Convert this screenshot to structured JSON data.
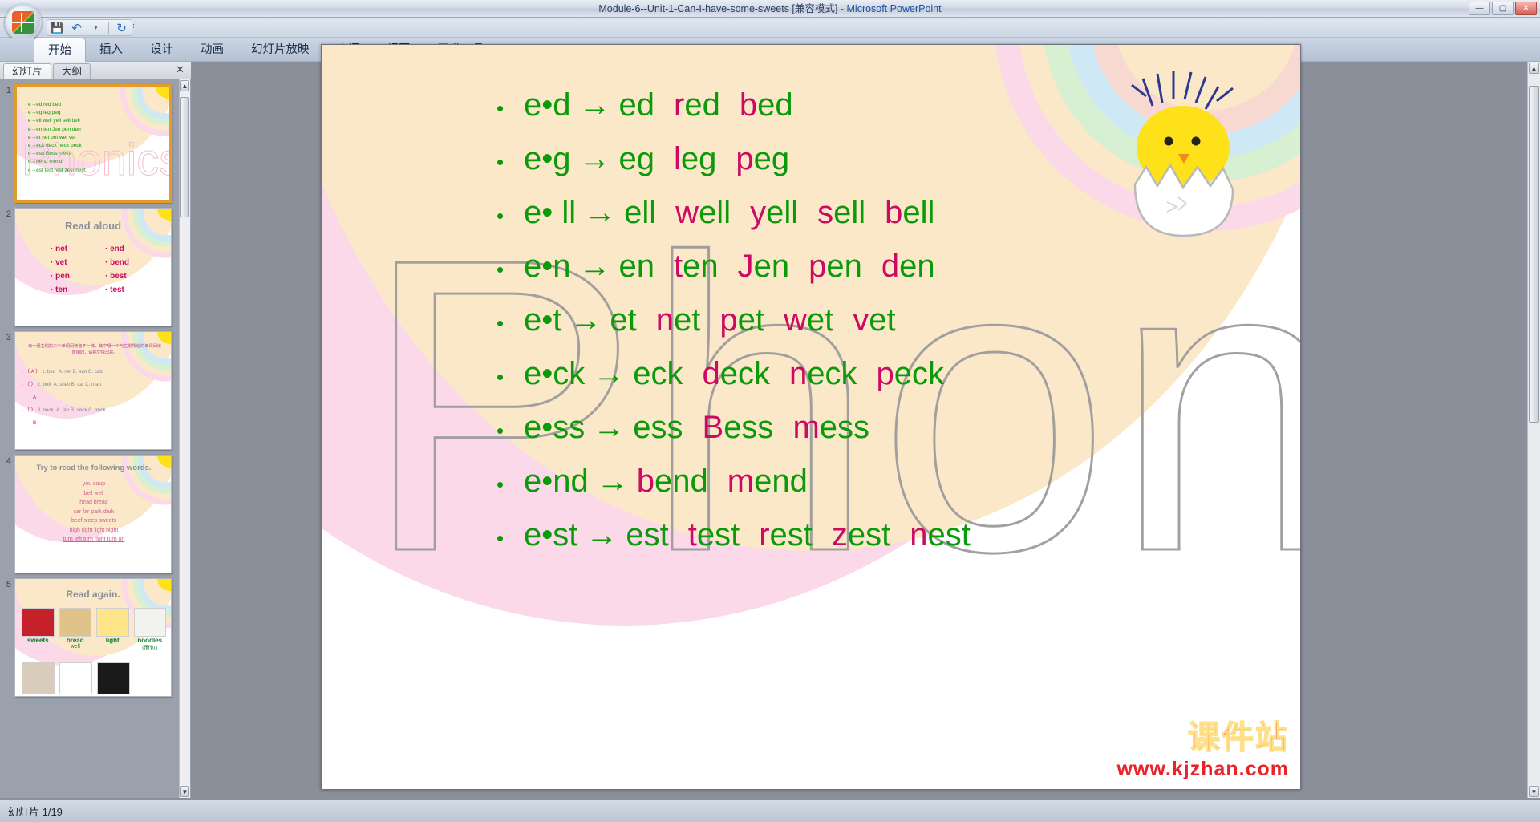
{
  "window": {
    "title": "Module-6--Unit-1-Can-I-have-some-sweets [兼容模式]",
    "separator": " - ",
    "app": "Microsoft PowerPoint",
    "minimize": "—",
    "maximize": "▢",
    "close": "✕"
  },
  "quick_access": {
    "save": "💾",
    "undo": "↶",
    "redo": "↻",
    "more": "▾",
    "customize": "⋮"
  },
  "ribbon": {
    "tabs": [
      {
        "label": "开始",
        "active": true
      },
      {
        "label": "插入",
        "active": false
      },
      {
        "label": "设计",
        "active": false
      },
      {
        "label": "动画",
        "active": false
      },
      {
        "label": "幻灯片放映",
        "active": false
      },
      {
        "label": "审阅",
        "active": false
      },
      {
        "label": "视图",
        "active": false
      },
      {
        "label": "开发工具",
        "active": false
      }
    ]
  },
  "left_pane": {
    "tab_slides": "幻灯片",
    "tab_outline": "大纲",
    "close": "✕",
    "scroll_up": "▲",
    "scroll_down": "▼",
    "thumbnails": [
      {
        "number": "1",
        "selected": true,
        "kind": "phonics",
        "lines": [
          "e→ed  red  bed",
          "e→eg  leg  peg",
          "e→ell  well  yell  sell  bell",
          "e→en  ten  Jen  pen  den",
          "e→et  net  pet  wet  vet",
          "e→eck  deck  neck  peck",
          "e→ess  Bess  mess",
          "e→bend  mend",
          "e→est  test  rest  zest  nest"
        ]
      },
      {
        "number": "2",
        "selected": false,
        "kind": "read-aloud",
        "title": "Read aloud",
        "col1": [
          "net",
          "vet",
          "pen",
          "ten"
        ],
        "col2": [
          "end",
          "bend",
          "best",
          "test"
        ]
      },
      {
        "number": "3",
        "selected": false,
        "kind": "quiz",
        "prompt": "每一组右侧的三个单词间读音不一样，其中哪一个与左侧所给的单词间读音相同，请把它找出来。",
        "questions": [
          {
            "bracket": "（ A ）",
            "stem": "1. bed",
            "options": "A. net    B. sun    C. cab",
            "answer": ""
          },
          {
            "bracket": "（   ）",
            "stem": "2. bell",
            "options": "A. shell   B. cat    C. map",
            "answer": "A"
          },
          {
            "bracket": "（   ）",
            "stem": "3. neck",
            "options": "A. fan     B. deck   C. truck",
            "answer": "B"
          }
        ]
      },
      {
        "number": "4",
        "selected": false,
        "kind": "read-words",
        "title": "Try to read the following  words.",
        "rows": [
          "you  soup",
          "bell  well",
          "head  bread",
          "car  far  park  dark",
          "beef  sleep  sweets",
          "high  right  light  night",
          "turn left   turn right   turn on"
        ]
      },
      {
        "number": "5",
        "selected": false,
        "kind": "read-again",
        "title": "Read again.",
        "cells": [
          "sweets",
          "bread",
          "light",
          "noodles"
        ],
        "cell_sub": [
          "",
          "well",
          "",
          "（面包）"
        ]
      }
    ]
  },
  "slide": {
    "watermark": "Phonics",
    "rows": [
      {
        "bullet": "•",
        "pattern_pre": "e•d",
        "arrow": "→",
        "words": [
          {
            "onset": "",
            "rime": "ed"
          },
          {
            "onset": "r",
            "rime": "ed"
          },
          {
            "onset": "b",
            "rime": "ed"
          }
        ]
      },
      {
        "bullet": "•",
        "pattern_pre": "e•g",
        "arrow": "→",
        "words": [
          {
            "onset": "",
            "rime": "eg"
          },
          {
            "onset": "l",
            "rime": "eg"
          },
          {
            "onset": "p",
            "rime": "eg"
          }
        ]
      },
      {
        "bullet": "•",
        "pattern_pre": "e• ll",
        "arrow": "→",
        "words": [
          {
            "onset": "",
            "rime": "ell"
          },
          {
            "onset": "w",
            "rime": "ell"
          },
          {
            "onset": "y",
            "rime": "ell"
          },
          {
            "onset": "s",
            "rime": "ell"
          },
          {
            "onset": "b",
            "rime": "ell"
          }
        ]
      },
      {
        "bullet": "•",
        "pattern_pre": "e•n",
        "arrow": "→",
        "words": [
          {
            "onset": "",
            "rime": "en"
          },
          {
            "onset": "t",
            "rime": "en"
          },
          {
            "onset": "J",
            "rime": "en"
          },
          {
            "onset": "p",
            "rime": "en"
          },
          {
            "onset": "d",
            "rime": "en"
          }
        ]
      },
      {
        "bullet": "•",
        "pattern_pre": "e•t",
        "arrow": "→",
        "words": [
          {
            "onset": "",
            "rime": "et"
          },
          {
            "onset": "n",
            "rime": "et"
          },
          {
            "onset": "p",
            "rime": "et"
          },
          {
            "onset": "w",
            "rime": "et"
          },
          {
            "onset": "v",
            "rime": "et"
          }
        ]
      },
      {
        "bullet": "•",
        "pattern_pre": "e•ck",
        "arrow": "→",
        "words": [
          {
            "onset": "",
            "rime": "eck"
          },
          {
            "onset": "d",
            "rime": "eck"
          },
          {
            "onset": "n",
            "rime": "eck"
          },
          {
            "onset": "p",
            "rime": "eck"
          }
        ]
      },
      {
        "bullet": "•",
        "pattern_pre": "e•ss",
        "arrow": "→",
        "words": [
          {
            "onset": "",
            "rime": "ess"
          },
          {
            "onset": "B",
            "rime": "ess"
          },
          {
            "onset": "m",
            "rime": "ess"
          }
        ]
      },
      {
        "bullet": "•",
        "pattern_pre": "e•nd",
        "arrow": "→",
        "words": [
          {
            "onset": "b",
            "rime": "end"
          },
          {
            "onset": "m",
            "rime": "end"
          }
        ]
      },
      {
        "bullet": "•",
        "pattern_pre": "e•st",
        "arrow": "→",
        "words": [
          {
            "onset": "",
            "rime": "est"
          },
          {
            "onset": "t",
            "rime": "est"
          },
          {
            "onset": "r",
            "rime": "est"
          },
          {
            "onset": "z",
            "rime": "est"
          },
          {
            "onset": "n",
            "rime": "est"
          }
        ]
      }
    ],
    "colors": {
      "rime": "#0a9a0a",
      "onset": "#cc0a63"
    },
    "logo": {
      "main": "课件站",
      "sub": "www.kjzhan.com"
    }
  },
  "status_bar": {
    "slide_counter": "幻灯片 1/19"
  }
}
